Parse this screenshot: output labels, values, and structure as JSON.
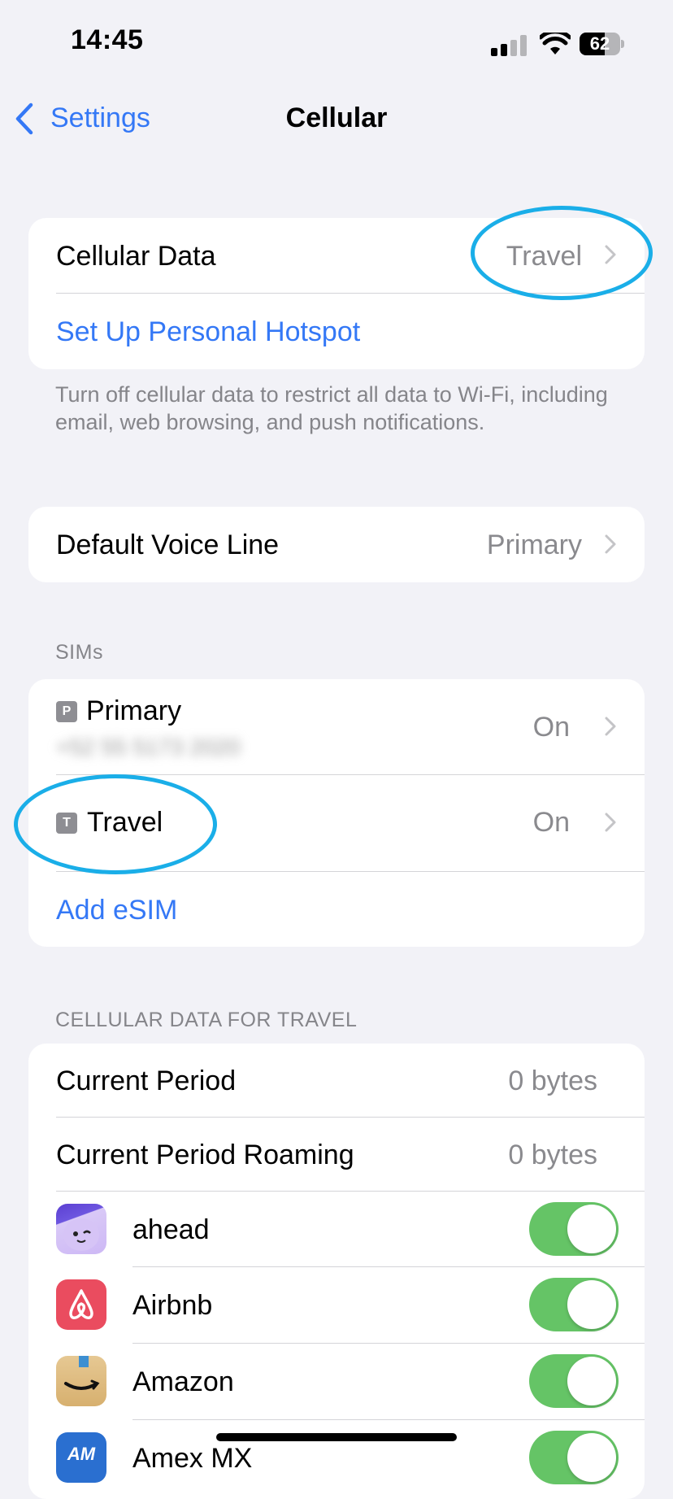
{
  "status_bar": {
    "time": "14:45",
    "battery": "62",
    "battery_level": 0.62
  },
  "nav": {
    "back_label": "Settings",
    "title": "Cellular"
  },
  "data_card": {
    "cellular_data_label": "Cellular Data",
    "cellular_data_value": "Travel",
    "hotspot_label": "Set Up Personal Hotspot"
  },
  "data_footer": "Turn off cellular data to restrict all data to Wi-Fi, including email, web browsing, and push notifications.",
  "voice_card": {
    "label": "Default Voice Line",
    "value": "Primary"
  },
  "sims": {
    "header": "SIMs",
    "items": [
      {
        "badge": "P",
        "name": "Primary",
        "number": "+52 55 5173 2020",
        "status": "On"
      },
      {
        "badge": "T",
        "name": "Travel",
        "status": "On"
      }
    ],
    "add_label": "Add eSIM"
  },
  "usage": {
    "header": "CELLULAR DATA FOR TRAVEL",
    "current_period_label": "Current Period",
    "current_period_value": "0 bytes",
    "roaming_label": "Current Period Roaming",
    "roaming_value": "0 bytes",
    "apps": [
      {
        "name": "ahead",
        "enabled": true
      },
      {
        "name": "Airbnb",
        "enabled": true
      },
      {
        "name": "Amazon",
        "enabled": true
      },
      {
        "name": "Amex MX",
        "enabled": true
      }
    ]
  },
  "colors": {
    "accent": "#3478f6",
    "toggle_on": "#65c466",
    "highlight_ring": "#1aaee8"
  }
}
